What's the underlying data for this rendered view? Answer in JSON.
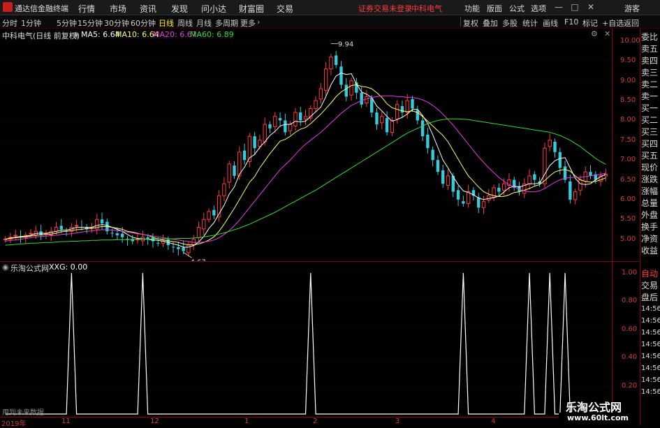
{
  "app": {
    "name": "通达信金融终端"
  },
  "menu": [
    "行情",
    "市场",
    "资讯",
    "发现",
    "问小达",
    "财富圈",
    "交易"
  ],
  "status": [
    "证券交易未登录",
    "中科电气"
  ],
  "right_menu": [
    "功能",
    "版面",
    "公式",
    "选项"
  ],
  "window_controls": {
    "min": "—",
    "max": "□",
    "close": "✕",
    "user": "游客"
  },
  "periods": [
    "分时",
    "1分钟",
    "5分钟",
    "15分钟",
    "30分钟",
    "60分钟",
    "日线",
    "周线",
    "月线",
    "多周期",
    "更多"
  ],
  "active_period": "日线",
  "tools": [
    "复权",
    "叠加",
    "多股",
    "统计",
    "画线",
    "F10",
    "标记",
    "+自选",
    "返回"
  ],
  "info": {
    "stock": "中科电气(日线 前复权)",
    "ma5": "MA5: 6.64",
    "ma10": "MA10: 6.64",
    "ma20": "MA20: 6.67",
    "ma60": "MA60: 6.89"
  },
  "sub_info": {
    "name": "乐淘公式网",
    "value": "XXG: 0.00",
    "footnote": "用到未来数据"
  },
  "colors": {
    "ma5": "#ffffff",
    "ma10": "#ffff66",
    "ma20": "#e040e0",
    "ma60": "#33dd33",
    "up": "#ff3c3c",
    "down": "#33ccdd",
    "grid": "#8b0000"
  },
  "side_labels": [
    "委比",
    "卖五",
    "卖四",
    "卖三",
    "卖二",
    "卖一",
    "买一",
    "买二",
    "买三",
    "买四",
    "买五",
    "现价",
    "涨跌",
    "涨幅",
    "总量",
    "外盘",
    "换手",
    "净资",
    "收益"
  ],
  "side_bottom": [
    "自动",
    "交易",
    "盘后",
    "14:56",
    "14:56",
    "14:56",
    "14:56",
    "14:56",
    "14:56",
    "14:56",
    "14:56"
  ],
  "brand": {
    "name": "乐淘公式网",
    "url": "www.60lt.com"
  },
  "chart_data": {
    "type": "candlestick",
    "price_axis": [
      "10.00",
      "9.50",
      "9.00",
      "8.50",
      "8.00",
      "7.50",
      "7.00",
      "6.50",
      "6.00",
      "5.50",
      "5.00"
    ],
    "ylim": [
      4.5,
      10.0
    ],
    "annotations": [
      {
        "label": "9.94"
      },
      {
        "label": "4.67"
      }
    ],
    "x_labels": [
      "2019年",
      "11",
      "12",
      "1",
      "2",
      "3",
      "4"
    ],
    "close": [
      5.0,
      5.05,
      5.1,
      5.05,
      5.1,
      5.15,
      5.2,
      5.1,
      5.15,
      5.2,
      5.3,
      5.25,
      5.2,
      5.3,
      5.35,
      5.3,
      5.25,
      5.3,
      5.5,
      5.4,
      5.2,
      5.15,
      5.1,
      5.05,
      5.0,
      4.95,
      5.0,
      5.05,
      5.0,
      4.95,
      4.9,
      4.95,
      4.85,
      4.8,
      4.75,
      4.7,
      4.85,
      5.0,
      5.3,
      5.5,
      5.7,
      5.6,
      6.1,
      6.4,
      6.9,
      6.6,
      7.2,
      7.0,
      7.6,
      7.3,
      7.5,
      7.9,
      7.8,
      8.1,
      8.0,
      7.7,
      7.9,
      8.2,
      8.0,
      8.1,
      8.3,
      8.5,
      8.8,
      9.3,
      9.6,
      9.4,
      8.9,
      8.6,
      9.0,
      8.7,
      8.4,
      8.6,
      8.2,
      7.9,
      8.1,
      7.7,
      8.0,
      8.4,
      8.2,
      8.5,
      8.3,
      8.0,
      7.6,
      7.3,
      7.0,
      6.7,
      6.4,
      6.6,
      6.2,
      6.0,
      5.9,
      6.2,
      6.1,
      5.8,
      5.95,
      6.1,
      6.3,
      6.2,
      6.4,
      6.5,
      6.3,
      6.2,
      6.4,
      6.6,
      6.5,
      6.4,
      7.3,
      7.5,
      7.2,
      6.8,
      6.5,
      6.0,
      6.2,
      6.5,
      6.7,
      6.6,
      6.5,
      6.6,
      6.64
    ],
    "series": [
      {
        "name": "MA5",
        "values": [
          5.0,
          5.03,
          5.05,
          5.07,
          5.08,
          5.1,
          5.15,
          5.15,
          5.15,
          5.17,
          5.2,
          5.23,
          5.23,
          5.26,
          5.3,
          5.3,
          5.3,
          5.3,
          5.35,
          5.37,
          5.35,
          5.3,
          5.25,
          5.2,
          5.12,
          5.05,
          5.02,
          5.01,
          5.0,
          4.98,
          4.97,
          4.95,
          4.92,
          4.88,
          4.85,
          4.8,
          4.8,
          4.84,
          4.93,
          5.07,
          5.27,
          5.42,
          5.64,
          5.86,
          6.14,
          6.32,
          6.64,
          6.82,
          7.06,
          7.14,
          7.32,
          7.46,
          7.62,
          7.72,
          7.86,
          7.9,
          7.9,
          7.98,
          7.96,
          7.98,
          8.1,
          8.22,
          8.34,
          8.6,
          8.9,
          9.12,
          9.2,
          9.16,
          9.18,
          8.92,
          8.72,
          8.66,
          8.58,
          8.36,
          8.24,
          8.1,
          7.98,
          8.02,
          8.08,
          8.16,
          8.28,
          8.28,
          8.12,
          7.92,
          7.64,
          7.32,
          7.0,
          6.8,
          6.58,
          6.38,
          6.22,
          6.18,
          6.12,
          6.04,
          6.0,
          6.03,
          6.05,
          6.09,
          6.19,
          6.3,
          6.34,
          6.32,
          6.36,
          6.4,
          6.4,
          6.42,
          6.64,
          6.86,
          6.98,
          7.04,
          7.06,
          6.8,
          6.54,
          6.4,
          6.38,
          6.4,
          6.5,
          6.58,
          6.64
        ]
      },
      {
        "name": "MA10",
        "values": [
          5.0,
          5.02,
          5.04,
          5.05,
          5.06,
          5.08,
          5.1,
          5.11,
          5.12,
          5.13,
          5.15,
          5.19,
          5.2,
          5.22,
          5.24,
          5.25,
          5.27,
          5.27,
          5.3,
          5.32,
          5.32,
          5.3,
          5.28,
          5.25,
          5.2,
          5.18,
          5.15,
          5.12,
          5.1,
          5.05,
          5.01,
          4.98,
          4.96,
          4.94,
          4.92,
          4.88,
          4.86,
          4.86,
          4.88,
          4.92,
          4.98,
          5.06,
          5.2,
          5.38,
          5.58,
          5.78,
          6.0,
          6.22,
          6.44,
          6.58,
          6.8,
          6.98,
          7.16,
          7.32,
          7.48,
          7.52,
          7.6,
          7.7,
          7.78,
          7.82,
          7.92,
          8.04,
          8.16,
          8.3,
          8.44,
          8.6,
          8.72,
          8.8,
          8.88,
          8.9,
          8.86,
          8.84,
          8.8,
          8.7,
          8.58,
          8.42,
          8.32,
          8.28,
          8.24,
          8.22,
          8.24,
          8.2,
          8.1,
          7.98,
          7.86,
          7.74,
          7.62,
          7.46,
          7.24,
          7.02,
          6.8,
          6.6,
          6.46,
          6.32,
          6.2,
          6.14,
          6.1,
          6.08,
          6.08,
          6.12,
          6.18,
          6.2,
          6.24,
          6.28,
          6.34,
          6.38,
          6.48,
          6.6,
          6.7,
          6.74,
          6.76,
          6.72,
          6.6,
          6.5,
          6.46,
          6.44,
          6.46,
          6.5,
          6.55
        ]
      },
      {
        "name": "MA20",
        "values": [
          4.95,
          4.97,
          4.98,
          5.0,
          5.02,
          5.04,
          5.06,
          5.07,
          5.08,
          5.09,
          5.1,
          5.12,
          5.13,
          5.14,
          5.16,
          5.18,
          5.2,
          5.21,
          5.23,
          5.24,
          5.24,
          5.23,
          5.22,
          5.2,
          5.18,
          5.16,
          5.14,
          5.12,
          5.1,
          5.08,
          5.06,
          5.04,
          5.02,
          5.0,
          4.98,
          4.96,
          4.94,
          4.92,
          4.92,
          4.93,
          4.95,
          4.98,
          5.04,
          5.12,
          5.22,
          5.34,
          5.48,
          5.64,
          5.8,
          5.96,
          6.12,
          6.28,
          6.44,
          6.6,
          6.76,
          6.88,
          7.0,
          7.14,
          7.28,
          7.4,
          7.5,
          7.6,
          7.7,
          7.82,
          7.94,
          8.06,
          8.18,
          8.28,
          8.38,
          8.44,
          8.5,
          8.54,
          8.58,
          8.6,
          8.62,
          8.62,
          8.62,
          8.6,
          8.6,
          8.58,
          8.58,
          8.56,
          8.52,
          8.46,
          8.38,
          8.28,
          8.16,
          8.02,
          7.88,
          7.72,
          7.56,
          7.4,
          7.24,
          7.08,
          6.94,
          6.8,
          6.68,
          6.56,
          6.46,
          6.38,
          6.32,
          6.26,
          6.22,
          6.2,
          6.2,
          6.22,
          6.28,
          6.36,
          6.44,
          6.5,
          6.54,
          6.56,
          6.56,
          6.56,
          6.58,
          6.6,
          6.62,
          6.64,
          6.67
        ]
      },
      {
        "name": "MA60",
        "values": [
          4.85,
          4.86,
          4.87,
          4.88,
          4.89,
          4.9,
          4.9,
          4.91,
          4.92,
          4.92,
          4.93,
          4.94,
          4.94,
          4.95,
          4.95,
          4.96,
          4.96,
          4.97,
          4.97,
          4.98,
          4.98,
          4.98,
          4.99,
          4.99,
          4.99,
          5.0,
          5.0,
          5.0,
          5.0,
          5.01,
          5.01,
          5.01,
          5.01,
          5.01,
          5.02,
          5.02,
          5.02,
          5.03,
          5.04,
          5.06,
          5.08,
          5.1,
          5.13,
          5.16,
          5.2,
          5.24,
          5.28,
          5.33,
          5.38,
          5.44,
          5.5,
          5.56,
          5.62,
          5.68,
          5.75,
          5.82,
          5.89,
          5.96,
          6.03,
          6.1,
          6.17,
          6.24,
          6.32,
          6.4,
          6.48,
          6.56,
          6.64,
          6.72,
          6.8,
          6.88,
          6.96,
          7.04,
          7.12,
          7.2,
          7.28,
          7.36,
          7.44,
          7.52,
          7.6,
          7.68,
          7.74,
          7.8,
          7.86,
          7.92,
          7.96,
          8.0,
          8.02,
          8.04,
          8.04,
          8.04,
          8.03,
          8.02,
          8.0,
          7.98,
          7.96,
          7.94,
          7.92,
          7.9,
          7.88,
          7.86,
          7.84,
          7.82,
          7.8,
          7.78,
          7.76,
          7.74,
          7.72,
          7.7,
          7.66,
          7.62,
          7.56,
          7.5,
          7.42,
          7.34,
          7.24,
          7.14,
          7.04,
          6.96,
          6.89
        ]
      }
    ],
    "sub": {
      "name": "XXG",
      "axis": [
        "1.00",
        "0.80",
        "0.60",
        "0.40",
        "0.20"
      ],
      "ylim": [
        0,
        1.0
      ],
      "spikes": [
        {
          "x": 13,
          "value": 1.0
        },
        {
          "x": 27,
          "value": 1.0
        },
        {
          "x": 60,
          "value": 1.0
        },
        {
          "x": 90,
          "value": 1.0
        },
        {
          "x": 103,
          "value": 1.0
        },
        {
          "x": 107,
          "value": 1.0
        },
        {
          "x": 110,
          "value": 1.0
        }
      ]
    }
  }
}
